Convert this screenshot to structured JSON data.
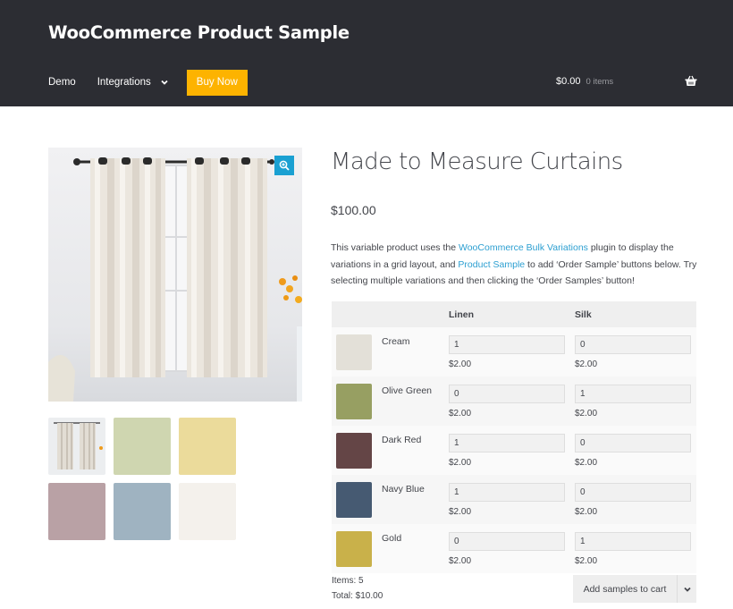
{
  "header": {
    "site_title": "WooCommerce Product Sample",
    "nav": [
      {
        "label": "Demo"
      },
      {
        "label": "Integrations",
        "has_dropdown": true
      }
    ],
    "buy_button": "Buy Now",
    "cart_amount": "$0.00",
    "cart_count": "0 items",
    "accent_color": "#fdb300",
    "bg_color": "#2c2d33"
  },
  "gallery": {
    "main_image_alt": "Cream curtains hanging on a rod in front of a window",
    "zoom_icon": "zoom-in-icon",
    "thumbnails": [
      {
        "name": "curtain-photo",
        "color": "#e9e7e3"
      },
      {
        "name": "sage-swatch",
        "color": "#cfd6b0"
      },
      {
        "name": "yellow-swatch",
        "color": "#ebdb9b"
      },
      {
        "name": "mauve-swatch",
        "color": "#b9a1a5"
      },
      {
        "name": "blue-swatch",
        "color": "#9fb3c1"
      },
      {
        "name": "white-swatch",
        "color": "#f4f1ec"
      }
    ]
  },
  "product": {
    "title": "Made to Measure Curtains",
    "price": "$100.00",
    "description": {
      "part1": "This variable product uses the ",
      "link1": "WooCommerce Bulk Variations",
      "part2": " plugin to display the variations in a grid layout, and ",
      "link2": "Product Sample",
      "part3": " to add ‘Order Sample’ buttons below. Try selecting multiple variations and then clicking the ‘Order Samples’ button!"
    },
    "link_color": "#2c9fd1"
  },
  "grid": {
    "columns": [
      "Linen",
      "Silk"
    ],
    "rows": [
      {
        "name": "Cream",
        "color": "#e3e0d8",
        "linen": "1",
        "silk": "0",
        "linen_price": "$2.00",
        "silk_price": "$2.00"
      },
      {
        "name": "Olive Green",
        "color": "#979f62",
        "linen": "0",
        "silk": "1",
        "linen_price": "$2.00",
        "silk_price": "$2.00"
      },
      {
        "name": "Dark Red",
        "color": "#644546",
        "linen": "1",
        "silk": "0",
        "linen_price": "$2.00",
        "silk_price": "$2.00"
      },
      {
        "name": "Navy Blue",
        "color": "#465a72",
        "linen": "1",
        "silk": "0",
        "linen_price": "$2.00",
        "silk_price": "$2.00"
      },
      {
        "name": "Gold",
        "color": "#c9b14a",
        "linen": "0",
        "silk": "1",
        "linen_price": "$2.00",
        "silk_price": "$2.00"
      }
    ]
  },
  "summary": {
    "items": "Items: 5",
    "total": "Total: $10.00"
  },
  "add_button": {
    "label": "Add samples to cart"
  }
}
